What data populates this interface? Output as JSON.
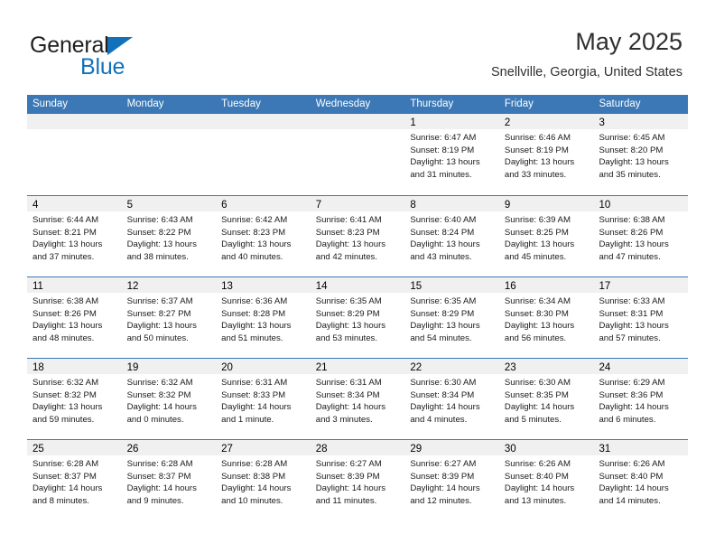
{
  "brand": {
    "name_part1": "General",
    "name_part2": "Blue",
    "logo_icon": "blue-triangle-icon",
    "accent_color": "#1271bb"
  },
  "header": {
    "title": "May 2025",
    "subtitle": "Snellville, Georgia, United States"
  },
  "colors": {
    "header_bar": "#3b78b5",
    "day_band": "#f0f0f0",
    "row_divider": "#3b78b5",
    "text": "#000000"
  },
  "weekdays": [
    "Sunday",
    "Monday",
    "Tuesday",
    "Wednesday",
    "Thursday",
    "Friday",
    "Saturday"
  ],
  "weeks": [
    [
      {
        "day": "",
        "empty": true
      },
      {
        "day": "",
        "empty": true
      },
      {
        "day": "",
        "empty": true
      },
      {
        "day": "",
        "empty": true
      },
      {
        "day": "1",
        "sunrise": "Sunrise: 6:47 AM",
        "sunset": "Sunset: 8:19 PM",
        "daylight1": "Daylight: 13 hours",
        "daylight2": "and 31 minutes."
      },
      {
        "day": "2",
        "sunrise": "Sunrise: 6:46 AM",
        "sunset": "Sunset: 8:19 PM",
        "daylight1": "Daylight: 13 hours",
        "daylight2": "and 33 minutes."
      },
      {
        "day": "3",
        "sunrise": "Sunrise: 6:45 AM",
        "sunset": "Sunset: 8:20 PM",
        "daylight1": "Daylight: 13 hours",
        "daylight2": "and 35 minutes."
      }
    ],
    [
      {
        "day": "4",
        "sunrise": "Sunrise: 6:44 AM",
        "sunset": "Sunset: 8:21 PM",
        "daylight1": "Daylight: 13 hours",
        "daylight2": "and 37 minutes."
      },
      {
        "day": "5",
        "sunrise": "Sunrise: 6:43 AM",
        "sunset": "Sunset: 8:22 PM",
        "daylight1": "Daylight: 13 hours",
        "daylight2": "and 38 minutes."
      },
      {
        "day": "6",
        "sunrise": "Sunrise: 6:42 AM",
        "sunset": "Sunset: 8:23 PM",
        "daylight1": "Daylight: 13 hours",
        "daylight2": "and 40 minutes."
      },
      {
        "day": "7",
        "sunrise": "Sunrise: 6:41 AM",
        "sunset": "Sunset: 8:23 PM",
        "daylight1": "Daylight: 13 hours",
        "daylight2": "and 42 minutes."
      },
      {
        "day": "8",
        "sunrise": "Sunrise: 6:40 AM",
        "sunset": "Sunset: 8:24 PM",
        "daylight1": "Daylight: 13 hours",
        "daylight2": "and 43 minutes."
      },
      {
        "day": "9",
        "sunrise": "Sunrise: 6:39 AM",
        "sunset": "Sunset: 8:25 PM",
        "daylight1": "Daylight: 13 hours",
        "daylight2": "and 45 minutes."
      },
      {
        "day": "10",
        "sunrise": "Sunrise: 6:38 AM",
        "sunset": "Sunset: 8:26 PM",
        "daylight1": "Daylight: 13 hours",
        "daylight2": "and 47 minutes."
      }
    ],
    [
      {
        "day": "11",
        "sunrise": "Sunrise: 6:38 AM",
        "sunset": "Sunset: 8:26 PM",
        "daylight1": "Daylight: 13 hours",
        "daylight2": "and 48 minutes."
      },
      {
        "day": "12",
        "sunrise": "Sunrise: 6:37 AM",
        "sunset": "Sunset: 8:27 PM",
        "daylight1": "Daylight: 13 hours",
        "daylight2": "and 50 minutes."
      },
      {
        "day": "13",
        "sunrise": "Sunrise: 6:36 AM",
        "sunset": "Sunset: 8:28 PM",
        "daylight1": "Daylight: 13 hours",
        "daylight2": "and 51 minutes."
      },
      {
        "day": "14",
        "sunrise": "Sunrise: 6:35 AM",
        "sunset": "Sunset: 8:29 PM",
        "daylight1": "Daylight: 13 hours",
        "daylight2": "and 53 minutes."
      },
      {
        "day": "15",
        "sunrise": "Sunrise: 6:35 AM",
        "sunset": "Sunset: 8:29 PM",
        "daylight1": "Daylight: 13 hours",
        "daylight2": "and 54 minutes."
      },
      {
        "day": "16",
        "sunrise": "Sunrise: 6:34 AM",
        "sunset": "Sunset: 8:30 PM",
        "daylight1": "Daylight: 13 hours",
        "daylight2": "and 56 minutes."
      },
      {
        "day": "17",
        "sunrise": "Sunrise: 6:33 AM",
        "sunset": "Sunset: 8:31 PM",
        "daylight1": "Daylight: 13 hours",
        "daylight2": "and 57 minutes."
      }
    ],
    [
      {
        "day": "18",
        "sunrise": "Sunrise: 6:32 AM",
        "sunset": "Sunset: 8:32 PM",
        "daylight1": "Daylight: 13 hours",
        "daylight2": "and 59 minutes."
      },
      {
        "day": "19",
        "sunrise": "Sunrise: 6:32 AM",
        "sunset": "Sunset: 8:32 PM",
        "daylight1": "Daylight: 14 hours",
        "daylight2": "and 0 minutes."
      },
      {
        "day": "20",
        "sunrise": "Sunrise: 6:31 AM",
        "sunset": "Sunset: 8:33 PM",
        "daylight1": "Daylight: 14 hours",
        "daylight2": "and 1 minute."
      },
      {
        "day": "21",
        "sunrise": "Sunrise: 6:31 AM",
        "sunset": "Sunset: 8:34 PM",
        "daylight1": "Daylight: 14 hours",
        "daylight2": "and 3 minutes."
      },
      {
        "day": "22",
        "sunrise": "Sunrise: 6:30 AM",
        "sunset": "Sunset: 8:34 PM",
        "daylight1": "Daylight: 14 hours",
        "daylight2": "and 4 minutes."
      },
      {
        "day": "23",
        "sunrise": "Sunrise: 6:30 AM",
        "sunset": "Sunset: 8:35 PM",
        "daylight1": "Daylight: 14 hours",
        "daylight2": "and 5 minutes."
      },
      {
        "day": "24",
        "sunrise": "Sunrise: 6:29 AM",
        "sunset": "Sunset: 8:36 PM",
        "daylight1": "Daylight: 14 hours",
        "daylight2": "and 6 minutes."
      }
    ],
    [
      {
        "day": "25",
        "sunrise": "Sunrise: 6:28 AM",
        "sunset": "Sunset: 8:37 PM",
        "daylight1": "Daylight: 14 hours",
        "daylight2": "and 8 minutes."
      },
      {
        "day": "26",
        "sunrise": "Sunrise: 6:28 AM",
        "sunset": "Sunset: 8:37 PM",
        "daylight1": "Daylight: 14 hours",
        "daylight2": "and 9 minutes."
      },
      {
        "day": "27",
        "sunrise": "Sunrise: 6:28 AM",
        "sunset": "Sunset: 8:38 PM",
        "daylight1": "Daylight: 14 hours",
        "daylight2": "and 10 minutes."
      },
      {
        "day": "28",
        "sunrise": "Sunrise: 6:27 AM",
        "sunset": "Sunset: 8:39 PM",
        "daylight1": "Daylight: 14 hours",
        "daylight2": "and 11 minutes."
      },
      {
        "day": "29",
        "sunrise": "Sunrise: 6:27 AM",
        "sunset": "Sunset: 8:39 PM",
        "daylight1": "Daylight: 14 hours",
        "daylight2": "and 12 minutes."
      },
      {
        "day": "30",
        "sunrise": "Sunrise: 6:26 AM",
        "sunset": "Sunset: 8:40 PM",
        "daylight1": "Daylight: 14 hours",
        "daylight2": "and 13 minutes."
      },
      {
        "day": "31",
        "sunrise": "Sunrise: 6:26 AM",
        "sunset": "Sunset: 8:40 PM",
        "daylight1": "Daylight: 14 hours",
        "daylight2": "and 14 minutes."
      }
    ]
  ]
}
